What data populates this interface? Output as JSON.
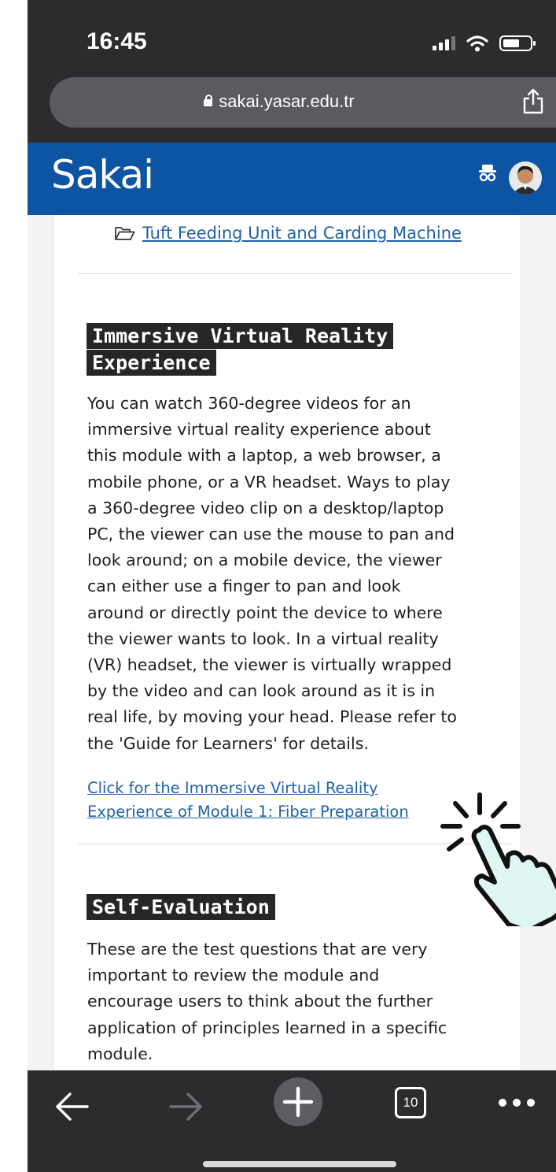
{
  "status_bar": {
    "time": "16:45"
  },
  "browser": {
    "url": "sakai.yasar.edu.tr"
  },
  "site": {
    "logo": "Sakai"
  },
  "content": {
    "folder_link": "Tuft Feeding Unit and Carding Machine",
    "vr_section": {
      "heading_line1": "Immersive Virtual Reality",
      "heading_line2": "Experience",
      "lines": [
        "You can watch 360-degree videos for an",
        "immersive virtual reality experience about",
        "this module with a laptop, a web browser, a",
        "mobile phone, or a VR headset. Ways to play",
        "a 360-degree video clip on a desktop/laptop",
        "PC, the viewer can use the mouse to pan and",
        "look around; on a mobile device, the viewer",
        "can either use a finger to pan and look",
        "around or directly point the device to where",
        "the viewer wants to look. In a virtual reality",
        "(VR) headset, the viewer is virtually wrapped",
        "by the video and can look around as it is in",
        "real life, by moving your head. Please refer to",
        "the 'Guide for Learners' for details."
      ],
      "link_line1": "Click for the Immersive Virtual Reality",
      "link_line2": "Experience of Module 1: Fiber Preparation"
    },
    "self_eval": {
      "heading": "Self-Evaluation",
      "lines": [
        "These are the test questions that are very",
        "important to review the module and",
        "encourage users to think about the further",
        "application of principles learned in a specific",
        "module."
      ]
    }
  },
  "toolbar": {
    "tab_count": "10"
  },
  "colors": {
    "sakai_blue": "#0d54a3",
    "link": "#1f62a8",
    "chrome": "#2c2c2e"
  }
}
